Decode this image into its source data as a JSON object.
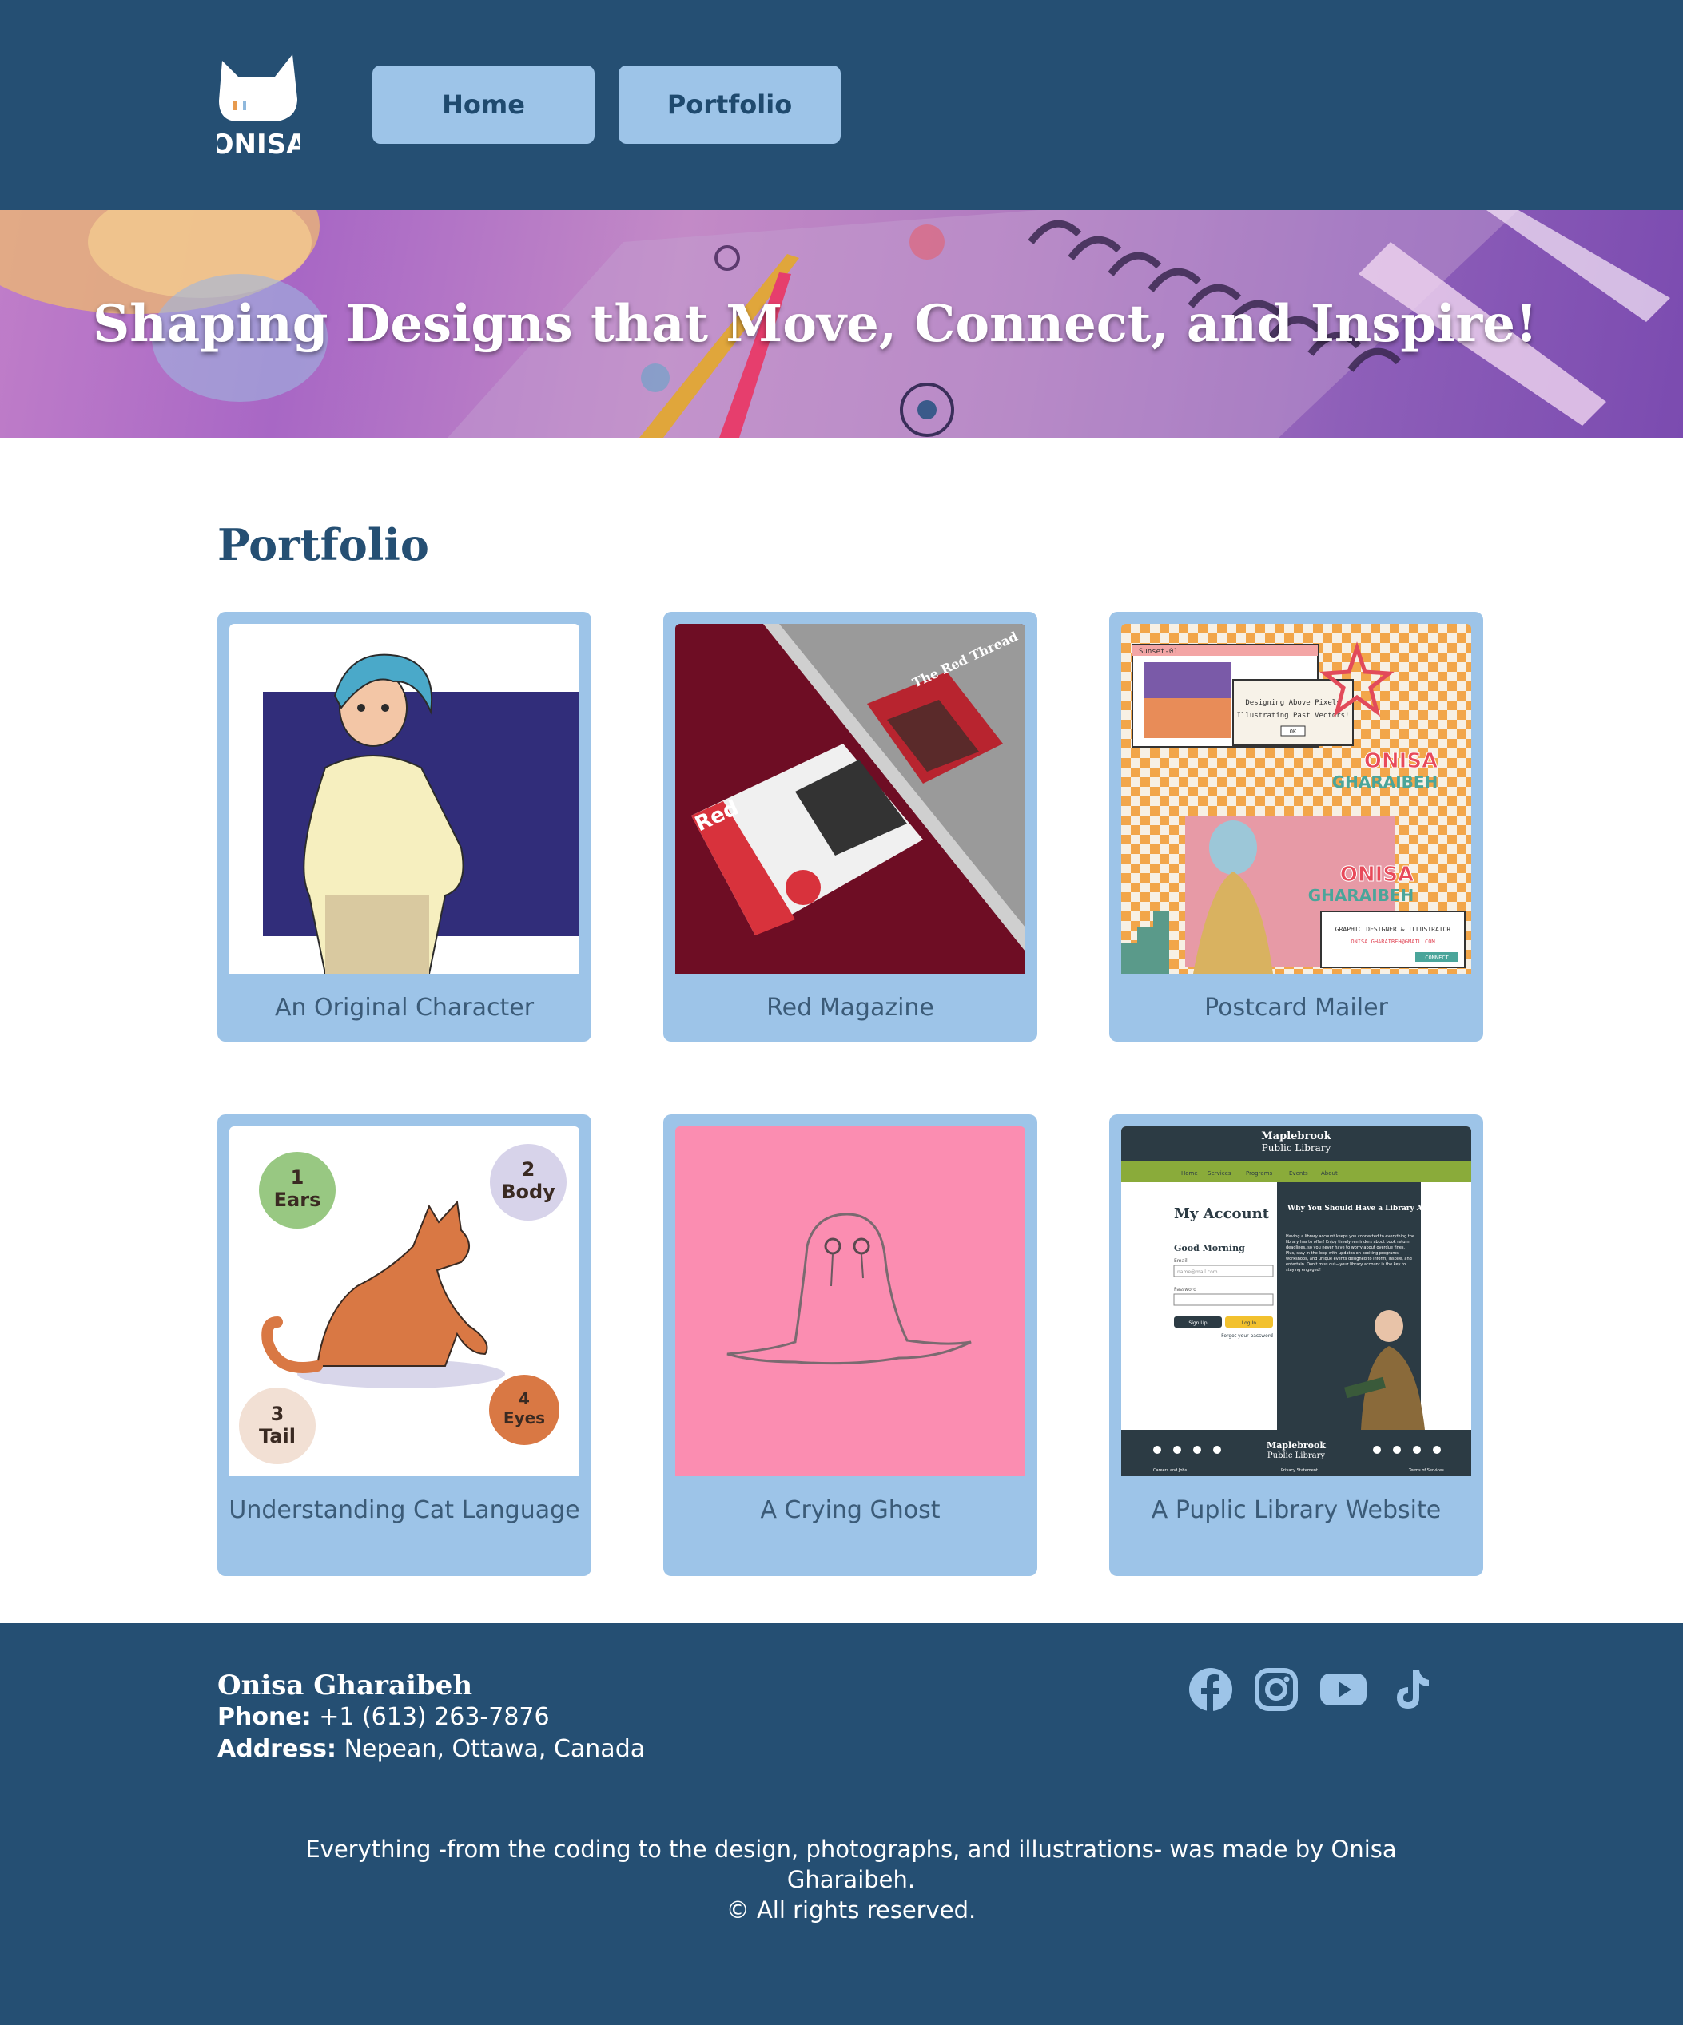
{
  "header": {
    "logo_text": "ONISA",
    "nav": [
      {
        "label": "Home"
      },
      {
        "label": "Portfolio"
      }
    ]
  },
  "hero": {
    "title": "Shaping Designs that Move, Connect, and Inspire!"
  },
  "main": {
    "section_title": "Portfolio",
    "cards": [
      {
        "caption": "An Original Character"
      },
      {
        "caption": "Red Magazine"
      },
      {
        "caption": "Postcard Mailer"
      },
      {
        "caption": "Understanding Cat Language"
      },
      {
        "caption": "A Crying Ghost"
      },
      {
        "caption": "A Puplic Library Website"
      }
    ],
    "thumbs": {
      "magazine": {
        "brand": "Red",
        "title": "The Red Thread"
      },
      "postcard": {
        "window_title": "Sunset-01",
        "line1": "Designing Above Pixels",
        "line2": "Illustrating Past Vectors!",
        "ok": "OK",
        "name": "ONISA",
        "surname": "GHARAIBEH",
        "role": "GRAPHIC DESIGNER & ILLUSTRATOR",
        "email": "ONISA.GHARAIBEH@GMAIL.COM",
        "connect": "CONNECT"
      },
      "cat": {
        "ears": {
          "num": "1",
          "label": "Ears"
        },
        "body": {
          "num": "2",
          "label": "Body"
        },
        "tail": {
          "num": "3",
          "label": "Tail"
        },
        "eyes": {
          "num": "4",
          "label": "Eyes"
        }
      },
      "library": {
        "name1": "Maplebrook",
        "name2": "Public Library",
        "nav": [
          "Home",
          "Services",
          "Programs",
          "Events",
          "About"
        ],
        "account_title": "My Account",
        "greeting": "Good Morning",
        "email_label": "Email",
        "email_ph": "name@mail.com",
        "password_label": "Password",
        "signup": "Sign Up",
        "login": "Log In",
        "forgot": "Forgot your password",
        "why_title": "Why You Should Have a Library Account?",
        "why_body": "Having a library account keeps you connected to everything the library has to offer! Enjoy timely reminders about book return deadlines, so you never have to worry about overdue fines. Plus, stay in the loop with updates on exciting programs, workshops, and unique events designed to inform, inspire, and entertain. Don't miss out—your library account is the key to staying engaged!",
        "footer_links": [
          "Careers and Jobs",
          "Privacy Statement",
          "Terms of Services"
        ]
      }
    }
  },
  "footer": {
    "name": "Onisa Gharaibeh",
    "phone_label": "Phone:",
    "phone": "+1 (613) 263-7876",
    "address_label": "Address:",
    "address": "Nepean, Ottawa, Canada",
    "social": [
      "facebook-icon",
      "instagram-icon",
      "youtube-icon",
      "tiktok-icon"
    ],
    "note_line1": "Everything -from the coding to the design, photographs, and illustrations- was made by Onisa Gharaibeh.",
    "note_line2": "© All rights reserved."
  },
  "colors": {
    "primary": "#254f73",
    "accent": "#9dc4e8",
    "text_muted": "#3b5b78"
  }
}
